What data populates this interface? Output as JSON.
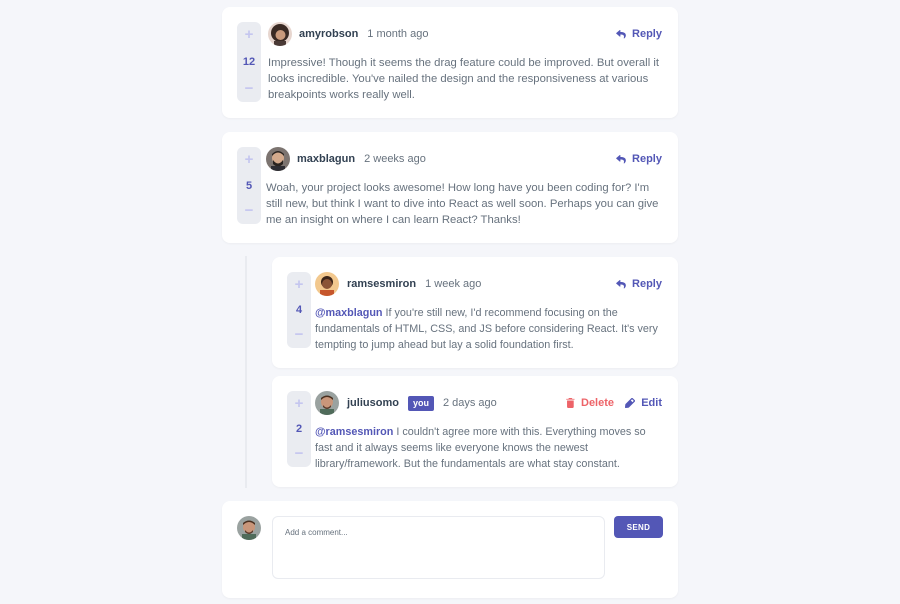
{
  "colors": {
    "primary": "#5357b6",
    "danger": "#ed6368",
    "background": "#f5f6fa",
    "card": "#ffffff",
    "vote_bg": "#eaecf1",
    "vote_icon": "#c5c6ef",
    "heading": "#324152",
    "body_text": "#67727e"
  },
  "icons": {
    "upvote": "+",
    "downvote": "−",
    "reply": "reply-arrow-icon",
    "delete": "trash-icon",
    "edit": "pencil-icon"
  },
  "comments": [
    {
      "username": "amyrobson",
      "time": "1 month ago",
      "score": "12",
      "reply_label": "Reply",
      "content": "Impressive! Though it seems the drag feature could be improved. But overall it looks incredible. You've nailed the design and the responsiveness at various breakpoints works really well."
    },
    {
      "username": "maxblagun",
      "time": "2 weeks ago",
      "score": "5",
      "reply_label": "Reply",
      "content": "Woah, your project looks awesome! How long have you been coding for? I'm still new, but think I want to dive into React as well soon. Perhaps you can give me an insight on where I can learn React? Thanks!"
    }
  ],
  "replies": [
    {
      "username": "ramsesmiron",
      "time": "1 week ago",
      "score": "4",
      "reply_label": "Reply",
      "mention": "@maxblagun",
      "content": " If you're still new, I'd recommend focusing on the fundamentals of HTML, CSS, and JS before considering React. It's very tempting to jump ahead but lay a solid foundation first."
    },
    {
      "username": "juliusomo",
      "you_badge": "you",
      "time": "2 days ago",
      "score": "2",
      "delete_label": "Delete",
      "edit_label": "Edit",
      "mention": "@ramsesmiron",
      "content": " I couldn't agree more with this. Everything moves so fast and it always seems like everyone knows the newest library/framework. But the fundamentals are what stay constant."
    }
  ],
  "new_comment": {
    "placeholder": "Add a comment...",
    "send_label": "SEND"
  }
}
